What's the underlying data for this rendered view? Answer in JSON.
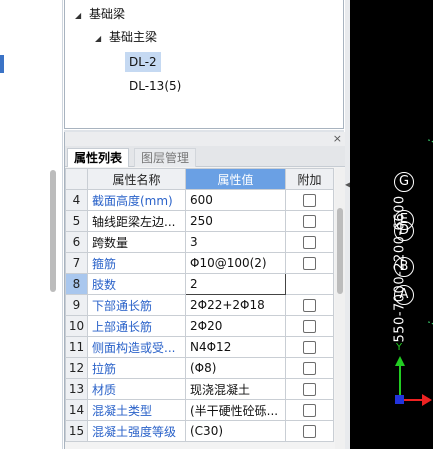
{
  "tree": {
    "root": "基础梁",
    "child": "基础主梁",
    "items": [
      "DL-2",
      "DL-13(5)"
    ]
  },
  "panel": {
    "close": "×",
    "tabs": [
      "属性列表",
      "图层管理"
    ]
  },
  "table": {
    "headers": [
      "属性名称",
      "属性值",
      "附加"
    ],
    "rows": [
      {
        "n": "4",
        "name": "截面高度(mm)",
        "value": "600"
      },
      {
        "n": "5",
        "name": "轴线距梁左边...",
        "value": "250"
      },
      {
        "n": "6",
        "name": "跨数量",
        "value": "3"
      },
      {
        "n": "7",
        "name": "箍筋",
        "value": "Φ10@100(2)"
      },
      {
        "n": "8",
        "name": "肢数",
        "value": "2"
      },
      {
        "n": "9",
        "name": "下部通长筋",
        "value": "2Φ22+2Φ18"
      },
      {
        "n": "10",
        "name": "上部通长筋",
        "value": "2Φ20"
      },
      {
        "n": "11",
        "name": "侧面构造或受...",
        "value": "N4Φ12"
      },
      {
        "n": "12",
        "name": "拉筋",
        "value": "(Φ8)"
      },
      {
        "n": "13",
        "name": "材质",
        "value": "现浇混凝土"
      },
      {
        "n": "14",
        "name": "混凝土类型",
        "value": "(半干硬性砼砾..."
      },
      {
        "n": "15",
        "name": "混凝土强度等级",
        "value": "(C30)"
      }
    ]
  },
  "canvas": {
    "axis_labels": [
      "G",
      "E",
      "D",
      "B",
      "A"
    ],
    "dimension_text": "550-7000-2200-6600",
    "ucs": {
      "y": "Y",
      "x": "X"
    }
  },
  "colors": {
    "highlight": "#6aa0e4",
    "link_blue": "#2a62c9",
    "selection": "#a9c7ee"
  }
}
